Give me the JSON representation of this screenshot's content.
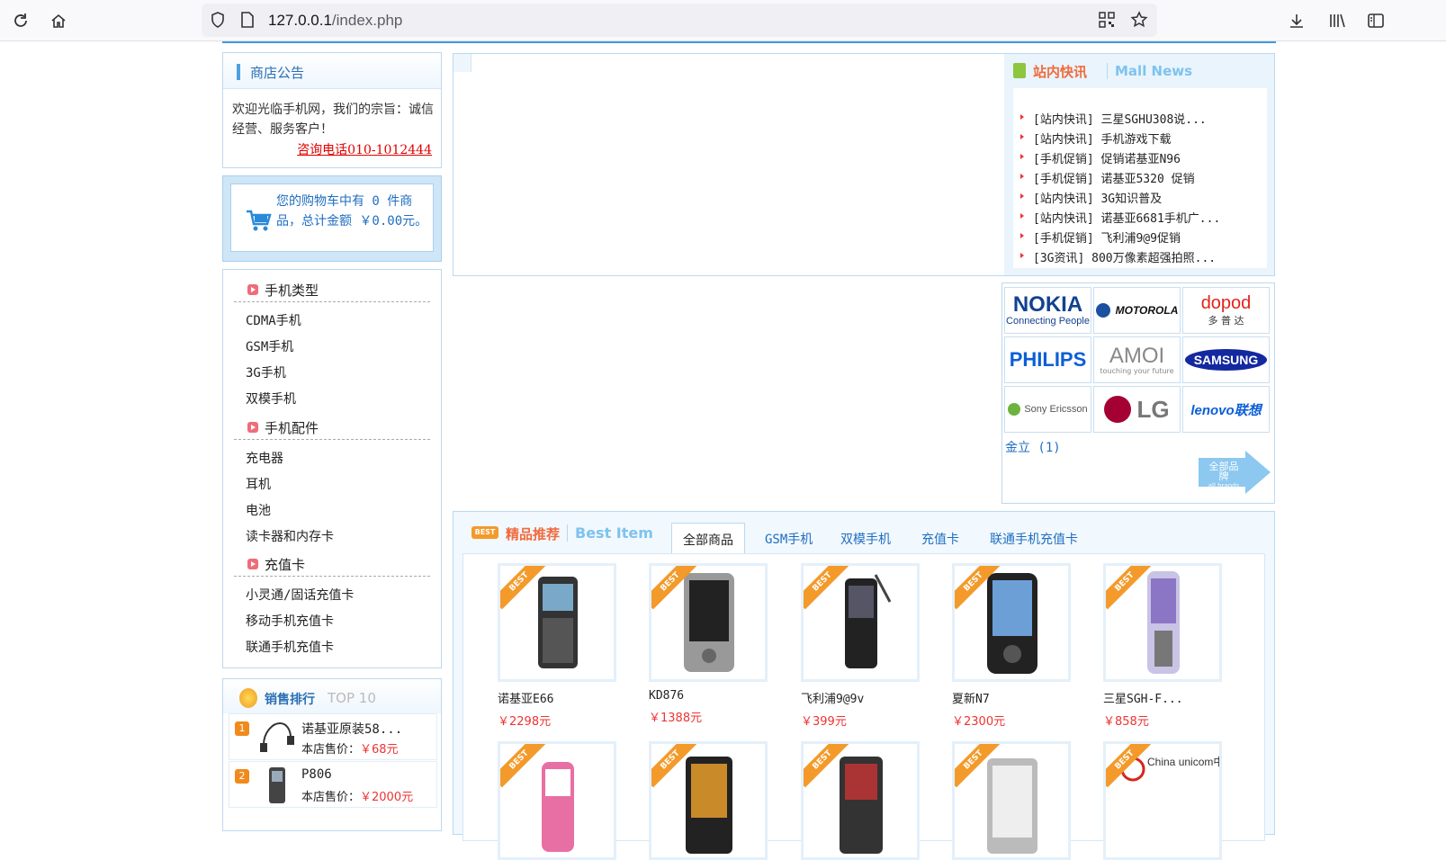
{
  "browser": {
    "url_host": "127.0.0.1",
    "url_path": "/index.php"
  },
  "notice": {
    "title": "商店公告",
    "text": "欢迎光临手机网，我们的宗旨：诚信经营、服务客户！",
    "link": "咨询电话010-1012444"
  },
  "cart": {
    "text": "您的购物车中有 0 件商品，总计金额 ￥0.00元。"
  },
  "categories": [
    {
      "title": "手机类型",
      "items": [
        "CDMA手机",
        "GSM手机",
        "3G手机",
        "双模手机"
      ]
    },
    {
      "title": "手机配件",
      "items": [
        "充电器",
        "耳机",
        "电池",
        "读卡器和内存卡"
      ]
    },
    {
      "title": "充值卡",
      "items": [
        "小灵通/固话充值卡",
        "移动手机充值卡",
        "联通手机充值卡"
      ]
    }
  ],
  "ranking": {
    "title": "销售排行",
    "sub": "TOP 10",
    "price_label": "本店售价：",
    "items": [
      {
        "num": "1",
        "name": "诺基亚原装58...",
        "price": "￥68元"
      },
      {
        "num": "2",
        "name": "P806",
        "price": "￥2000元"
      }
    ]
  },
  "news": {
    "title": "站内快讯",
    "sub": "Mall News",
    "items": [
      "[站内快讯] 三星SGHU308说...",
      "[站内快讯] 手机游戏下载",
      "[手机促销] 促销诺基亚N96",
      "[手机促销] 诺基亚5320 促销",
      "[站内快讯] 3G知识普及",
      "[站内快讯] 诺基亚6681手机广...",
      "[手机促销] 飞利浦9@9促销",
      "[3G资讯] 800万像素超强拍照..."
    ]
  },
  "brands": {
    "cells": [
      {
        "label": "NOKIA",
        "sub": "Connecting People",
        "color": "#124191"
      },
      {
        "label": "MOTOROLA",
        "sub": "",
        "color": "#111111"
      },
      {
        "label": "dopod",
        "sub": "多 普 达",
        "color": "#e2231a"
      },
      {
        "label": "PHILIPS",
        "sub": "",
        "color": "#0b5ed7"
      },
      {
        "label": "AMOI",
        "sub": "touching your future",
        "color": "#888888"
      },
      {
        "label": "SAMSUNG",
        "sub": "",
        "color": "#1428a0"
      },
      {
        "label": "Sony Ericsson",
        "sub": "",
        "color": "#555555"
      },
      {
        "label": "LG",
        "sub": "",
        "color": "#a50034"
      },
      {
        "label": "lenovo联想",
        "sub": "",
        "color": "#0b5ed7"
      }
    ],
    "link": "金立 (1)",
    "all_label": "全部品牌",
    "all_sub": "all brands"
  },
  "best": {
    "badge": "BEST",
    "title": "精品推荐",
    "sub": "Best Item",
    "tabs": [
      "全部商品",
      "GSM手机",
      "双模手机",
      "充值卡",
      "联通手机充值卡"
    ],
    "products": [
      {
        "name": "诺基亚E66",
        "price": "￥2298元"
      },
      {
        "name": "KD876",
        "price": "￥1388元"
      },
      {
        "name": "飞利浦9@9v",
        "price": "￥399元"
      },
      {
        "name": "夏新N7",
        "price": "￥2300元"
      },
      {
        "name": "三星SGH-F...",
        "price": "￥858元"
      }
    ],
    "unicom_label": "China unicom中国联通"
  }
}
